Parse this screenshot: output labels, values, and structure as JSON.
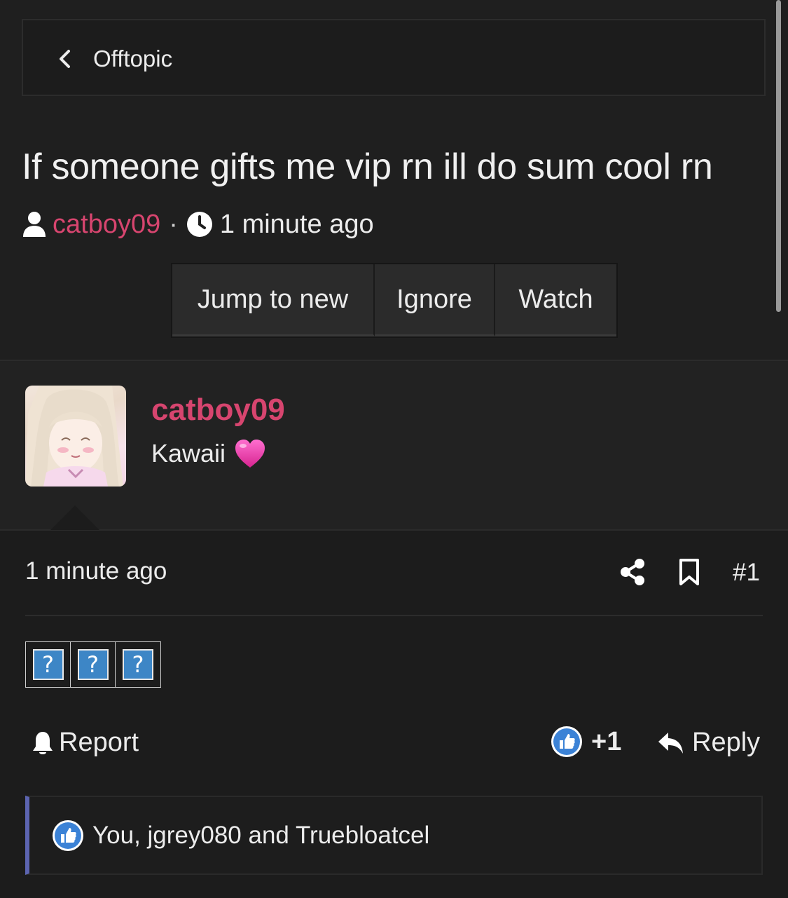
{
  "breadcrumb": {
    "label": "Offtopic"
  },
  "thread": {
    "title": "If someone gifts me vip rn ill do sum cool rn",
    "author": "catboy09",
    "separator": "·",
    "time": "1 minute ago"
  },
  "actions": [
    {
      "label": "Jump to new"
    },
    {
      "label": "Ignore"
    },
    {
      "label": "Watch"
    }
  ],
  "post": {
    "username": "catboy09",
    "user_title": "Kawaii",
    "time": "1 minute ago",
    "number": "#1",
    "content_glyphs": [
      "?",
      "?",
      "?"
    ],
    "report_label": "Report",
    "reaction_count": "+1",
    "reply_label": "Reply",
    "reactions_text": "You, jgrey080 and Truebloatcel"
  },
  "colors": {
    "background": "#1f1f1f",
    "accent_username": "#d7456f",
    "reaction_bar_accent": "#5c64b0",
    "like_blue": "#3b82d6"
  },
  "icons": [
    "chevron-left-icon",
    "user-icon",
    "clock-icon",
    "heart-icon",
    "share-icon",
    "bookmark-icon",
    "bell-icon",
    "like-icon",
    "reply-icon"
  ]
}
